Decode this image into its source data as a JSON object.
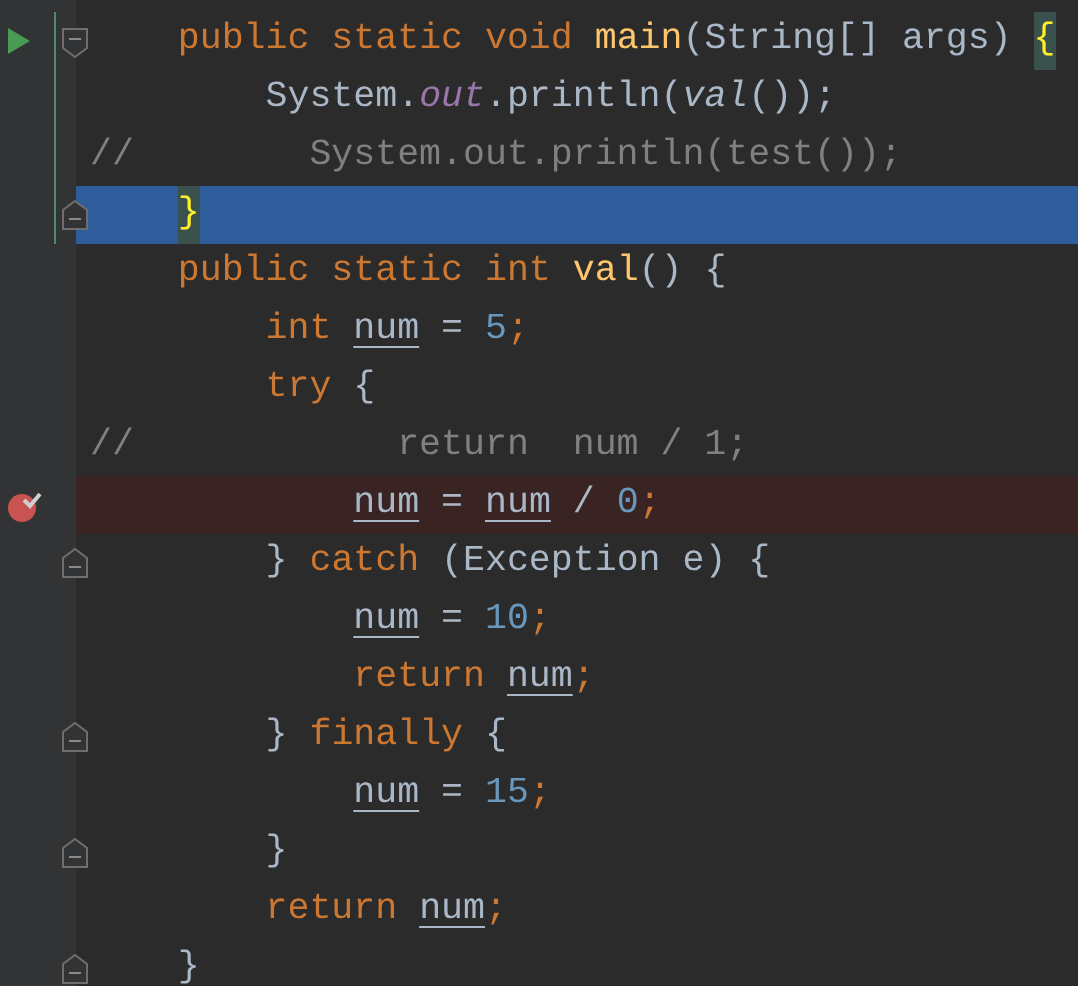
{
  "editor": {
    "lines": [
      {
        "run_button": true,
        "fold_start": true,
        "selected": false,
        "breakpoint": false,
        "tokens": [
          {
            "text": "    public static void ",
            "kind": "keyword"
          },
          {
            "text": "main",
            "kind": "method"
          },
          {
            "text": "(String[] args) ",
            "kind": "plain"
          },
          {
            "text": "{",
            "kind": "brace"
          }
        ]
      },
      {
        "tokens": [
          {
            "text": "        System.",
            "kind": "plain"
          },
          {
            "text": "out",
            "kind": "field"
          },
          {
            "text": ".println(",
            "kind": "plain"
          },
          {
            "text": "val",
            "kind": "call"
          },
          {
            "text": "());",
            "kind": "plain"
          }
        ],
        "selected": false,
        "breakpoint": false
      },
      {
        "tokens": [
          {
            "text": "//        System.out.println(test());",
            "kind": "comment"
          }
        ],
        "selected": false,
        "breakpoint": false
      },
      {
        "fold_end": true,
        "selected": true,
        "breakpoint": false,
        "tokens": [
          {
            "text": "    }",
            "kind": "brace"
          }
        ]
      },
      {
        "tokens": [
          {
            "text": "    public static int ",
            "kind": "keyword"
          },
          {
            "text": "val",
            "kind": "method"
          },
          {
            "text": "() {",
            "kind": "plain"
          }
        ],
        "selected": false,
        "breakpoint": false
      },
      {
        "tokens": [
          {
            "text": "        int ",
            "kind": "keyword"
          },
          {
            "text": "num",
            "kind": "var"
          },
          {
            "text": " = ",
            "kind": "plain"
          },
          {
            "text": "5",
            "kind": "number"
          },
          {
            "text": ";",
            "kind": "keyword"
          }
        ],
        "selected": false,
        "breakpoint": false
      },
      {
        "tokens": [
          {
            "text": "        try",
            "kind": "keyword"
          },
          {
            "text": " {",
            "kind": "plain"
          }
        ],
        "selected": false,
        "breakpoint": false
      },
      {
        "tokens": [
          {
            "text": "//            return  num / 1;",
            "kind": "comment"
          }
        ],
        "selected": false,
        "breakpoint": false
      },
      {
        "selected": false,
        "breakpoint": true,
        "tokens": [
          {
            "text": "            num",
            "kind": "var"
          },
          {
            "text": " = ",
            "kind": "plain"
          },
          {
            "text": "num",
            "kind": "var"
          },
          {
            "text": " / ",
            "kind": "plain"
          },
          {
            "text": "0",
            "kind": "number"
          },
          {
            "text": ";",
            "kind": "keyword"
          }
        ]
      },
      {
        "fold_end": true,
        "selected": false,
        "breakpoint": false,
        "tokens": [
          {
            "text": "        } ",
            "kind": "plain"
          },
          {
            "text": "catch",
            "kind": "keyword"
          },
          {
            "text": " (Exception e) {",
            "kind": "plain"
          }
        ]
      },
      {
        "tokens": [
          {
            "text": "            num",
            "kind": "var"
          },
          {
            "text": " = ",
            "kind": "plain"
          },
          {
            "text": "10",
            "kind": "number"
          },
          {
            "text": ";",
            "kind": "keyword"
          }
        ],
        "selected": false,
        "breakpoint": false
      },
      {
        "tokens": [
          {
            "text": "            return ",
            "kind": "keyword"
          },
          {
            "text": "num",
            "kind": "var"
          },
          {
            "text": ";",
            "kind": "keyword"
          }
        ],
        "selected": false,
        "breakpoint": false
      },
      {
        "fold_end": true,
        "selected": false,
        "breakpoint": false,
        "tokens": [
          {
            "text": "        } ",
            "kind": "plain"
          },
          {
            "text": "finally",
            "kind": "keyword"
          },
          {
            "text": " {",
            "kind": "plain"
          }
        ]
      },
      {
        "tokens": [
          {
            "text": "            num",
            "kind": "var"
          },
          {
            "text": " = ",
            "kind": "plain"
          },
          {
            "text": "15",
            "kind": "number"
          },
          {
            "text": ";",
            "kind": "keyword"
          }
        ],
        "selected": false,
        "breakpoint": false
      },
      {
        "fold_end": true,
        "selected": false,
        "breakpoint": false,
        "tokens": [
          {
            "text": "        }",
            "kind": "plain"
          }
        ]
      },
      {
        "tokens": [
          {
            "text": "        return ",
            "kind": "keyword"
          },
          {
            "text": "num",
            "kind": "var"
          },
          {
            "text": ";",
            "kind": "keyword"
          }
        ],
        "selected": false,
        "breakpoint": false
      },
      {
        "fold_end": true,
        "selected": false,
        "breakpoint": false,
        "tokens": [
          {
            "text": "    }",
            "kind": "plain"
          }
        ]
      }
    ]
  }
}
